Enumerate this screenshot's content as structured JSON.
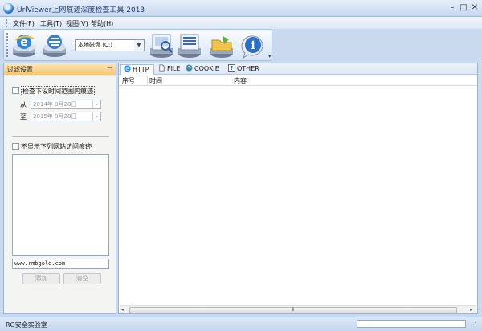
{
  "window": {
    "title": "UrlViewer上网痕迹深度检查工具 2013"
  },
  "menu": [
    "文件(F)",
    "工具(T)",
    "视图(V)",
    "帮助(H)"
  ],
  "toolbar": {
    "drive_value": "本地磁盘 (C:)",
    "icons": [
      "ie-browser-icon",
      "other-browser-icon",
      "scan-search-icon",
      "list-view-icon",
      "folder-icon",
      "info-icon"
    ]
  },
  "filter_panel": {
    "title": "过滤设置",
    "check_time_label": "检查下设时间范围内痕迹",
    "from_label": "从",
    "to_label": "至",
    "from_date": "2014年  8月28日",
    "to_date": "2015年  8月28日",
    "hide_sites_label": "不显示下列网站访问痕迹",
    "site_input_value": "www.rmbgold.com",
    "add_button": "添加",
    "clear_button": "清空"
  },
  "tabs": [
    "HTTP",
    "FILE",
    "COOKIE",
    "OTHER"
  ],
  "columns": [
    "序号",
    "时间",
    "内容"
  ],
  "status": {
    "text": "RG安全实验室"
  },
  "colors": {
    "accent": "#f7c66d",
    "frame": "#c9d9ee"
  }
}
